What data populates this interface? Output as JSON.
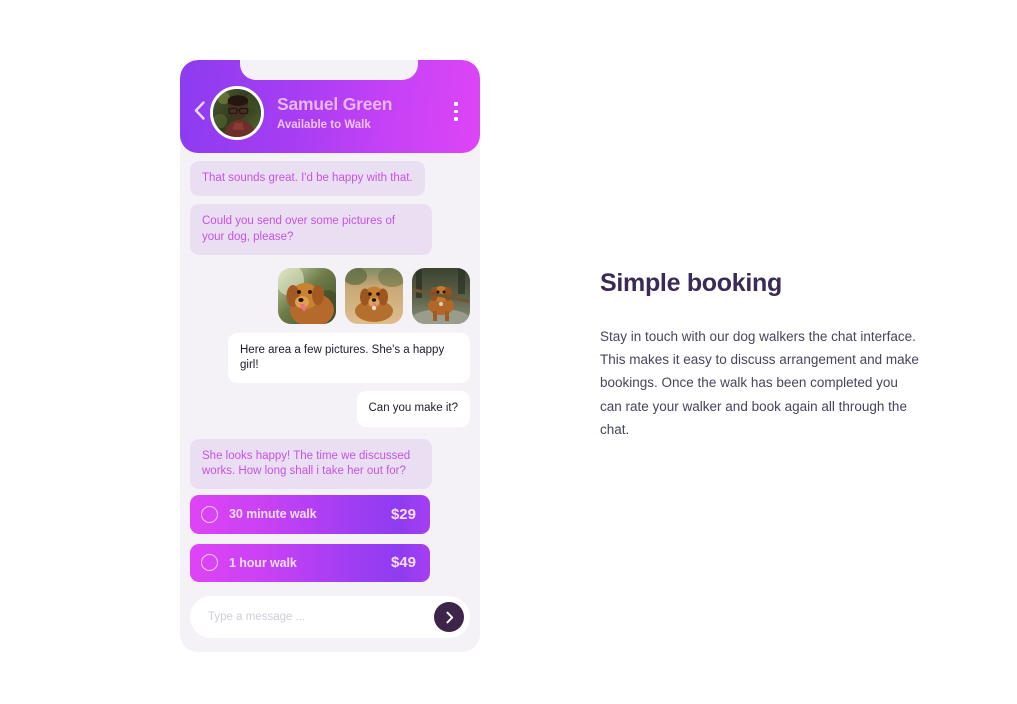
{
  "chat": {
    "header": {
      "back_icon": "chevron-left-icon",
      "avatar_alt": "samuel-green-avatar",
      "name": "Samuel Green",
      "status": "Available to Walk",
      "menu_icon": "kebab-menu-icon"
    },
    "messages": [
      {
        "side": "received",
        "text": "That sounds great. I'd be happy with that."
      },
      {
        "side": "received",
        "text": "Could you send over some pictures of your dog, please?"
      },
      {
        "side": "sent",
        "text": "Here area a few pictures. She's a happy girl!"
      },
      {
        "side": "sent",
        "text": "Can you make it?"
      },
      {
        "side": "received",
        "text": "She looks happy! The time we discussed works. How long shall i take her out for?"
      }
    ],
    "photos": [
      {
        "alt": "dog-photo-closeup"
      },
      {
        "alt": "dog-photo-sitting"
      },
      {
        "alt": "dog-photo-with-stick"
      }
    ],
    "options": [
      {
        "label": "30 minute walk",
        "price": "$29",
        "selected": false
      },
      {
        "label": "1 hour walk",
        "price": "$49",
        "selected": false
      }
    ],
    "composer": {
      "value": "",
      "placeholder": "Type a message ...",
      "send_icon": "chevron-right-icon"
    }
  },
  "content": {
    "title": "Simple booking",
    "body": "Stay in touch with our dog walkers the chat interface. This makes it easy to discuss arrangement and make bookings. Once the walk has been completed you can rate your walker and book again all through the chat."
  },
  "colors": {
    "gradient_start": "#8c3cf0",
    "gradient_end": "#dd45f6",
    "page_bg": "#ffffff",
    "panel_bg": "#f4f1f7",
    "received_bubble": "#eadff2",
    "received_text": "#c552e8",
    "sent_bubble": "#ffffff",
    "sent_text": "#1b1b2a",
    "send_button": "#3d2449",
    "title_text": "#3b2a55",
    "body_text": "#45455c"
  }
}
